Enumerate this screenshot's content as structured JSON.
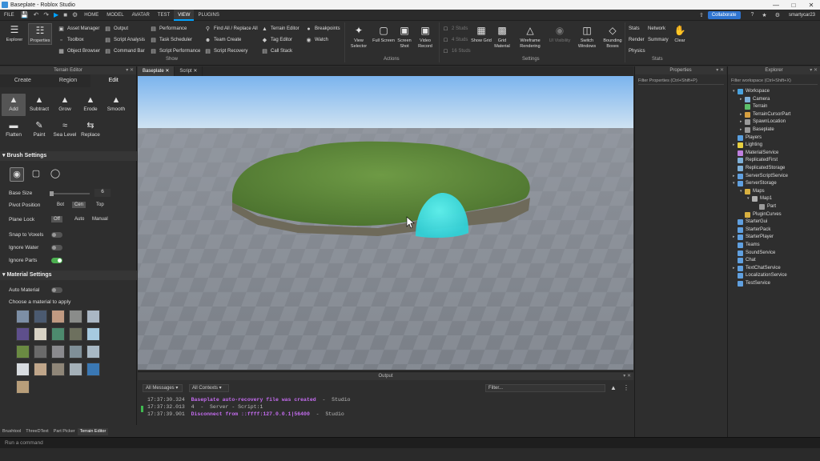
{
  "window": {
    "title": "Baseplate - Roblox Studio"
  },
  "menu": {
    "file": "FILE",
    "tabs": [
      "HOME",
      "MODEL",
      "AVATAR",
      "TEST",
      "VIEW",
      "PLUGINS"
    ],
    "active_tab": "VIEW",
    "collaborate": "Collaborate",
    "username": "smartycar23"
  },
  "ribbon": {
    "big_left": [
      {
        "label": "Explorer"
      },
      {
        "label": "Properties"
      }
    ],
    "col1": [
      "Asset Manager",
      "Toolbox",
      "Object Browser"
    ],
    "col2": [
      "Output",
      "Script Analysis",
      "Command Bar"
    ],
    "col3": [
      "Performance",
      "Task Scheduler",
      "Script Performance"
    ],
    "col4": [
      "Find All / Replace All",
      "Team Create",
      "Script Recovery"
    ],
    "col5": [
      "Terrain Editor",
      "Tag Editor",
      "Call Stack"
    ],
    "col6": [
      "Breakpoints",
      "Watch"
    ],
    "show_group": "Show",
    "actions": [
      "View Selector",
      "Full Screen",
      "Screen Shot",
      "Video Record"
    ],
    "actions_group": "Actions",
    "studs": [
      "2 Studs",
      "4 Studs",
      "16 Studs"
    ],
    "settings": [
      "Show Grid",
      "Grid Material",
      "Wireframe Rendering",
      "UI Visibility",
      "Switch Windows",
      "Bounding Boxes"
    ],
    "settings_group": "Settings",
    "stats": [
      "Stats",
      "Network",
      "Render",
      "Summary",
      "Physics",
      "Clear"
    ],
    "stats_group": "Stats"
  },
  "terrain": {
    "panel_title": "Terrain Editor",
    "tabs": [
      "Create",
      "Region",
      "Edit"
    ],
    "active_tab": "Edit",
    "tools": [
      "Add",
      "Subtract",
      "Grow",
      "Erode",
      "Smooth",
      "Flatten",
      "Paint",
      "Sea Level",
      "Replace"
    ],
    "selected_tool": "Add",
    "brush_settings": "Brush Settings",
    "base_size_label": "Base Size",
    "base_size_value": "6",
    "pivot_label": "Pivot Position",
    "pivot_options": [
      "Bot",
      "Cen",
      "Top"
    ],
    "pivot_selected": "Cen",
    "plane_lock_label": "Plane Lock",
    "plane_lock_options": [
      "Off",
      "Auto",
      "Manual"
    ],
    "plane_lock_selected": "Off",
    "snap_label": "Snap to Voxels",
    "snap_on": false,
    "ignore_water_label": "Ignore Water",
    "ignore_water_on": false,
    "ignore_parts_label": "Ignore Parts",
    "ignore_parts_on": true,
    "material_settings": "Material Settings",
    "auto_material_label": "Auto Material",
    "auto_material_on": false,
    "choose_material": "Choose a material to apply",
    "materials": [
      "#7d8fa6",
      "#4b5a70",
      "#c09a82",
      "#8a8c8a",
      "#aab7c4",
      "#5e4f8c",
      "#d8d2c4",
      "#4d8a6e",
      "#6d705e",
      "#a6cae0",
      "#6a8a42",
      "#6a6a6a",
      "#8a8a8e",
      "#7f8f98",
      "#a8b8c4",
      "#d8dce0",
      "#c0a68a",
      "#8f8678",
      "#a4b0b8",
      "#3a78b4",
      "#b89e7a"
    ]
  },
  "bottom_tabs": [
    "Brushtool",
    "ThreeDText",
    "Part Picker",
    "Terrain Editor"
  ],
  "bottom_tabs_active": "Terrain Editor",
  "doc_tabs": [
    "Baseplate",
    "Script"
  ],
  "doc_tab_active": "Baseplate",
  "output": {
    "title": "Output",
    "filter_messages": "All Messages",
    "filter_contexts": "All Contexts",
    "filter_placeholder": "Filter...",
    "logs": [
      {
        "time": "17:37:30.324",
        "msg": "Baseplate auto-recovery file was created",
        "src": "Studio"
      },
      {
        "time": "17:37:32.013",
        "msg": "4  -  Server - Script:1",
        "src": ""
      },
      {
        "time": "17:37:39.901",
        "msg": "Disconnect from ::ffff:127.0.0.1|56400",
        "src": "Studio"
      }
    ]
  },
  "properties": {
    "title": "Properties",
    "filter": "Filter Properties (Ctrl+Shift+P)"
  },
  "explorer": {
    "title": "Explorer",
    "filter": "Filter workspace (Ctrl+Shift+X)",
    "tree": [
      {
        "label": "Workspace",
        "depth": 0,
        "arrow": "▾",
        "color": "#4aa3df"
      },
      {
        "label": "Camera",
        "depth": 1,
        "arrow": "▸",
        "color": "#7fb0d8"
      },
      {
        "label": "Terrain",
        "depth": 1,
        "arrow": "",
        "color": "#5cbf6a"
      },
      {
        "label": "TerrainCursorPart",
        "depth": 1,
        "arrow": "▸",
        "color": "#d8a040"
      },
      {
        "label": "SpawnLocation",
        "depth": 1,
        "arrow": "▸",
        "color": "#9a9a9a"
      },
      {
        "label": "Baseplate",
        "depth": 1,
        "arrow": "▸",
        "color": "#9a9a9a"
      },
      {
        "label": "Players",
        "depth": 0,
        "arrow": "",
        "color": "#5aa0e0"
      },
      {
        "label": "Lighting",
        "depth": 0,
        "arrow": "▸",
        "color": "#e8d040"
      },
      {
        "label": "MaterialService",
        "depth": 0,
        "arrow": "",
        "color": "#c080e0"
      },
      {
        "label": "ReplicatedFirst",
        "depth": 0,
        "arrow": "",
        "color": "#7fb0d8"
      },
      {
        "label": "ReplicatedStorage",
        "depth": 0,
        "arrow": "",
        "color": "#7fb0d8"
      },
      {
        "label": "ServerScriptService",
        "depth": 0,
        "arrow": "▸",
        "color": "#60a0e0"
      },
      {
        "label": "ServerStorage",
        "depth": 0,
        "arrow": "▾",
        "color": "#60a0e0"
      },
      {
        "label": "Maps",
        "depth": 1,
        "arrow": "▾",
        "color": "#d8b040"
      },
      {
        "label": "Map1",
        "depth": 2,
        "arrow": "▾",
        "color": "#b0b0b0"
      },
      {
        "label": "Part",
        "depth": 3,
        "arrow": "",
        "color": "#9a9a9a"
      },
      {
        "label": "PluginCurves",
        "depth": 1,
        "arrow": "",
        "color": "#d8b040"
      },
      {
        "label": "StarterGui",
        "depth": 0,
        "arrow": "",
        "color": "#60a0e0"
      },
      {
        "label": "StarterPack",
        "depth": 0,
        "arrow": "",
        "color": "#60a0e0"
      },
      {
        "label": "StarterPlayer",
        "depth": 0,
        "arrow": "▸",
        "color": "#60a0e0"
      },
      {
        "label": "Teams",
        "depth": 0,
        "arrow": "",
        "color": "#60a0e0"
      },
      {
        "label": "SoundService",
        "depth": 0,
        "arrow": "",
        "color": "#60a0e0"
      },
      {
        "label": "Chat",
        "depth": 0,
        "arrow": "",
        "color": "#60a0e0"
      },
      {
        "label": "TextChatService",
        "depth": 0,
        "arrow": "▸",
        "color": "#60a0e0"
      },
      {
        "label": "LocalizationService",
        "depth": 0,
        "arrow": "",
        "color": "#60a0e0"
      },
      {
        "label": "TestService",
        "depth": 0,
        "arrow": "",
        "color": "#60a0e0"
      }
    ]
  },
  "command_placeholder": "Run a command",
  "colors": {
    "accent": "#00a2ff",
    "brush": "#3ee6e6",
    "grass": "#5f8a3c",
    "sky_top": "#7bb4ee",
    "sky_bottom": "#cfe4f6"
  }
}
